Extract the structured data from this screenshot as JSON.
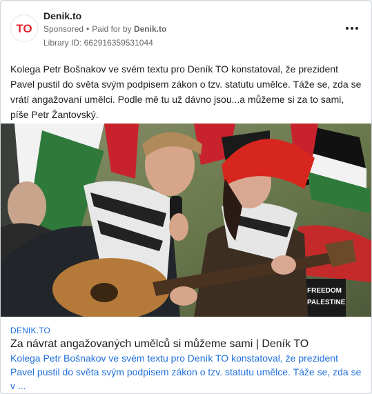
{
  "advertiser": {
    "name": "Denik.to",
    "sponsored_label": "Sponsored",
    "separator": "•",
    "paid_for_label": "Paid for by",
    "paid_for_name": "Denik.to",
    "library_id": "Library ID: 662916359531044",
    "logo_text": "TO",
    "logo_color": "#e3262c"
  },
  "menu": {
    "icon": "more-horizontal-icon",
    "glyph": "•••"
  },
  "ad_text": "Kolega Petr Bošnakov ve svém textu pro Deník TO konstatoval, že prezident Pavel pustil do světa svým podpisem zákon o tzv. statutu umělce. Táže se, zda se vrátí angažovaní umělci. Podle mě tu už dávno jsou...a můžeme si za to sami, píše Petr Žantovský.",
  "image": {
    "subject": "Man singing into a microphone and woman in a red beanie playing an acoustic guitar at a street demonstration with flags",
    "banner_text": [
      "FREEDOM",
      "PALESTINE"
    ]
  },
  "link": {
    "domain": "DENIK.TO",
    "headline": "Za návrat angažovaných umělců si můžeme sami | Deník TO",
    "description": "Kolega Petr Bošnakov ve svém textu pro Deník TO konstatoval, že prezident Pavel pustil do světa svým podpisem zákon o tzv. statutu umělce. Táže se, zda se v ..."
  },
  "colors": {
    "accent_blue": "#1f6fdd",
    "brand_red": "#e3262c",
    "muted": "#65676b"
  }
}
